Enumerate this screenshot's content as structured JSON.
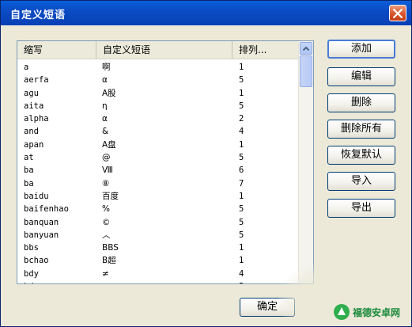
{
  "window": {
    "title": "自定义短语"
  },
  "list": {
    "columns": [
      "缩写",
      "自定义短语",
      "排列..."
    ],
    "rows": [
      {
        "abbr": "a",
        "phrase": "啊",
        "order": "1"
      },
      {
        "abbr": "aerfa",
        "phrase": "α",
        "order": "5"
      },
      {
        "abbr": "agu",
        "phrase": "A股",
        "order": "1"
      },
      {
        "abbr": "aita",
        "phrase": "η",
        "order": "5"
      },
      {
        "abbr": "alpha",
        "phrase": "α",
        "order": "2"
      },
      {
        "abbr": "and",
        "phrase": "&",
        "order": "4"
      },
      {
        "abbr": "apan",
        "phrase": "A盘",
        "order": "1"
      },
      {
        "abbr": "at",
        "phrase": "@",
        "order": "5"
      },
      {
        "abbr": "ba",
        "phrase": "Ⅷ",
        "order": "6"
      },
      {
        "abbr": "ba",
        "phrase": "⑧",
        "order": "7"
      },
      {
        "abbr": "baidu",
        "phrase": "百度",
        "order": "1"
      },
      {
        "abbr": "baifenhao",
        "phrase": "%",
        "order": "5"
      },
      {
        "abbr": "banquan",
        "phrase": "©",
        "order": "5"
      },
      {
        "abbr": "banyuan",
        "phrase": "︿",
        "order": "5"
      },
      {
        "abbr": "bbs",
        "phrase": "BBS",
        "order": "1"
      },
      {
        "abbr": "bchao",
        "phrase": "B超",
        "order": "1"
      },
      {
        "abbr": "bdy",
        "phrase": "≠",
        "order": "4"
      },
      {
        "abbr": "bdy",
        "phrase": "≯",
        "order": "5"
      }
    ]
  },
  "buttons": {
    "add": "添加",
    "edit": "编辑",
    "delete": "删除",
    "delete_all": "删除所有",
    "restore_default": "恢复默认",
    "import": "导入",
    "export": "导出",
    "ok": "确定"
  },
  "watermark": {
    "text": "福德安卓网"
  }
}
